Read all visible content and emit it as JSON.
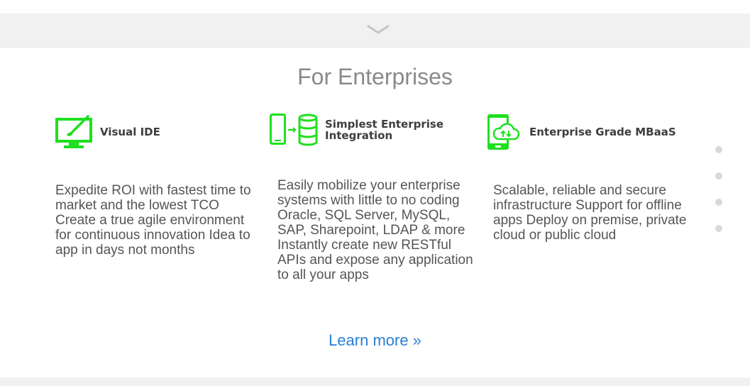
{
  "section": {
    "title": "For Enterprises"
  },
  "features": [
    {
      "icon": "monitor-brush-icon",
      "heading": "Visual IDE",
      "text": "Expedite ROI with fastest time to market and the lowest TCO Create a true agile environment for continuous innovation Idea to app in days not months"
    },
    {
      "icon": "phone-database-icon",
      "heading_line1": "Simplest Enterprise",
      "heading_line2": "Integration",
      "text": "Easily mobilize your enterprise systems with little to no coding Oracle, SQL Server, MySQL, SAP, Sharepoint, LDAP & more Instantly create new RESTful APIs and expose any application to all your apps"
    },
    {
      "icon": "phone-cloud-sync-icon",
      "heading": "Enterprise Grade MBaaS",
      "text": "Scalable, reliable and secure infrastructure Support for offline apps Deploy on premise, private cloud or public cloud"
    }
  ],
  "learn_more": "Learn more »",
  "pager": {
    "dot_count": 4
  },
  "colors": {
    "accent_green": "#1ee01e",
    "link_blue": "#2a7fd4",
    "band_gray": "#f1f1f1",
    "title_gray": "#8a8a8a"
  }
}
